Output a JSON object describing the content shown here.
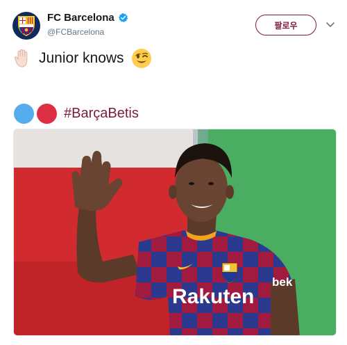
{
  "tweet": {
    "author": {
      "display_name": "FC Barcelona",
      "handle": "@FCBarcelona",
      "verified": true,
      "avatar_icon": "fc-barcelona-crest-icon"
    },
    "follow_label": "팔로우",
    "text": {
      "line1": "Junior knows",
      "line1_lead_emoji": "raised-hand-icon",
      "line1_trail_emoji": "winking-face-icon",
      "hashtag": "#BarçaBetis",
      "hashtag_lead_emojis": [
        "blue-circle-icon",
        "red-circle-icon"
      ]
    },
    "media": {
      "type": "photo",
      "jersey_sponsor": "Rakuten",
      "sleeve_text": "bek"
    }
  },
  "colors": {
    "accent": "#7d1a3b",
    "verified_blue": "#1da1f2",
    "handle_gray": "#657786",
    "blue_circle": "#55acee",
    "red_circle": "#dd2e44"
  }
}
